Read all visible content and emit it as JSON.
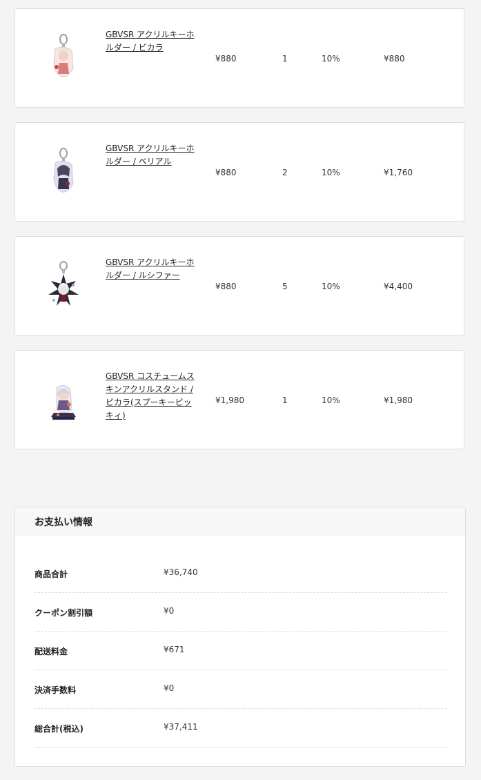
{
  "order_items": [
    {
      "name": "GBVSR アクリルキーホルダー / ビカラ",
      "thumbnail_icon": "acrylic-keychain-thumbnail",
      "unit_price": "¥880",
      "quantity": "1",
      "tax_rate": "10%",
      "subtotal": "¥880"
    },
    {
      "name": "GBVSR アクリルキーホルダー / ベリアル",
      "thumbnail_icon": "acrylic-keychain-thumbnail",
      "unit_price": "¥880",
      "quantity": "2",
      "tax_rate": "10%",
      "subtotal": "¥1,760"
    },
    {
      "name": "GBVSR アクリルキーホルダー / ルシファー",
      "thumbnail_icon": "acrylic-keychain-thumbnail",
      "unit_price": "¥880",
      "quantity": "5",
      "tax_rate": "10%",
      "subtotal": "¥4,400"
    },
    {
      "name": "GBVSR コスチュームスキンアクリルスタンド / ビカラ(スプーキービッキィ)",
      "thumbnail_icon": "acrylic-stand-thumbnail",
      "unit_price": "¥1,980",
      "quantity": "1",
      "tax_rate": "10%",
      "subtotal": "¥1,980"
    }
  ],
  "payment": {
    "title": "お支払い情報",
    "rows": [
      {
        "label": "商品合計",
        "value": "¥36,740"
      },
      {
        "label": "クーポン割引額",
        "value": "¥0"
      },
      {
        "label": "配送料金",
        "value": "¥671"
      },
      {
        "label": "決済手数料",
        "value": "¥0"
      },
      {
        "label": "総合計(税込)",
        "value": "¥37,411"
      }
    ]
  },
  "colors": {
    "page_background": "#f4f4f4",
    "card_background": "#ffffff",
    "card_border": "#dddddd",
    "header_background": "#f7f7f7",
    "text": "#222222"
  }
}
